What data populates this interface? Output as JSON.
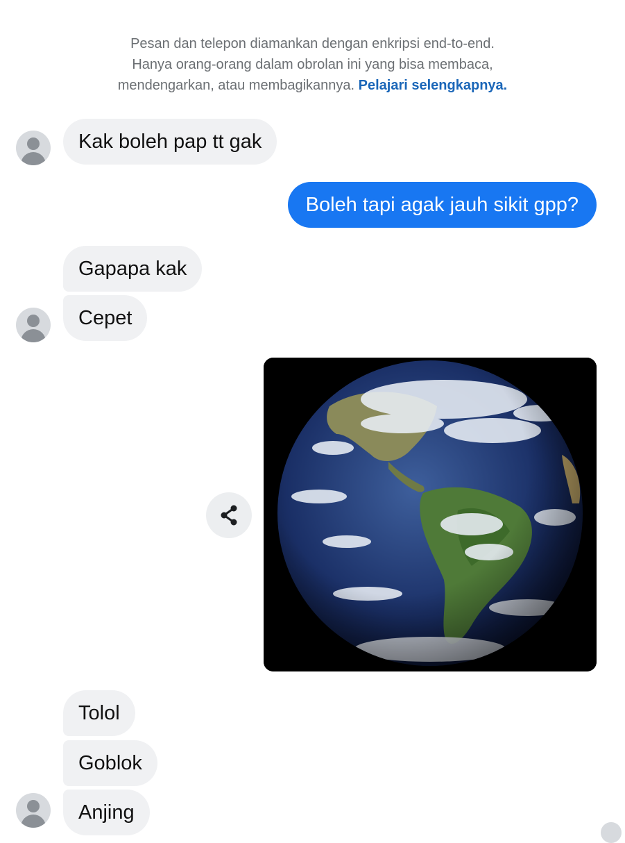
{
  "notice": {
    "line1": "Pesan dan telepon diamankan dengan enkripsi end-to-end.",
    "line2": "Hanya orang-orang dalam obrolan ini yang bisa membaca,",
    "line3": "mendengarkan, atau membagikannya.",
    "link": "Pelajari selengkapnya."
  },
  "messages": {
    "m1": "Kak boleh pap tt gak",
    "m2": "Boleh tapi agak jauh sikit gpp?",
    "m3": "Gapapa kak",
    "m4": "Cepet",
    "m5": "Tolol",
    "m6": "Goblok",
    "m7": "Anjing"
  },
  "icons": {
    "avatar": "default-avatar-icon",
    "share": "share-icon",
    "attachment": "earth-photo"
  },
  "colors": {
    "outgoing_bubble": "#1877f2",
    "incoming_bubble": "#f0f1f3",
    "link": "#1a66b8"
  }
}
